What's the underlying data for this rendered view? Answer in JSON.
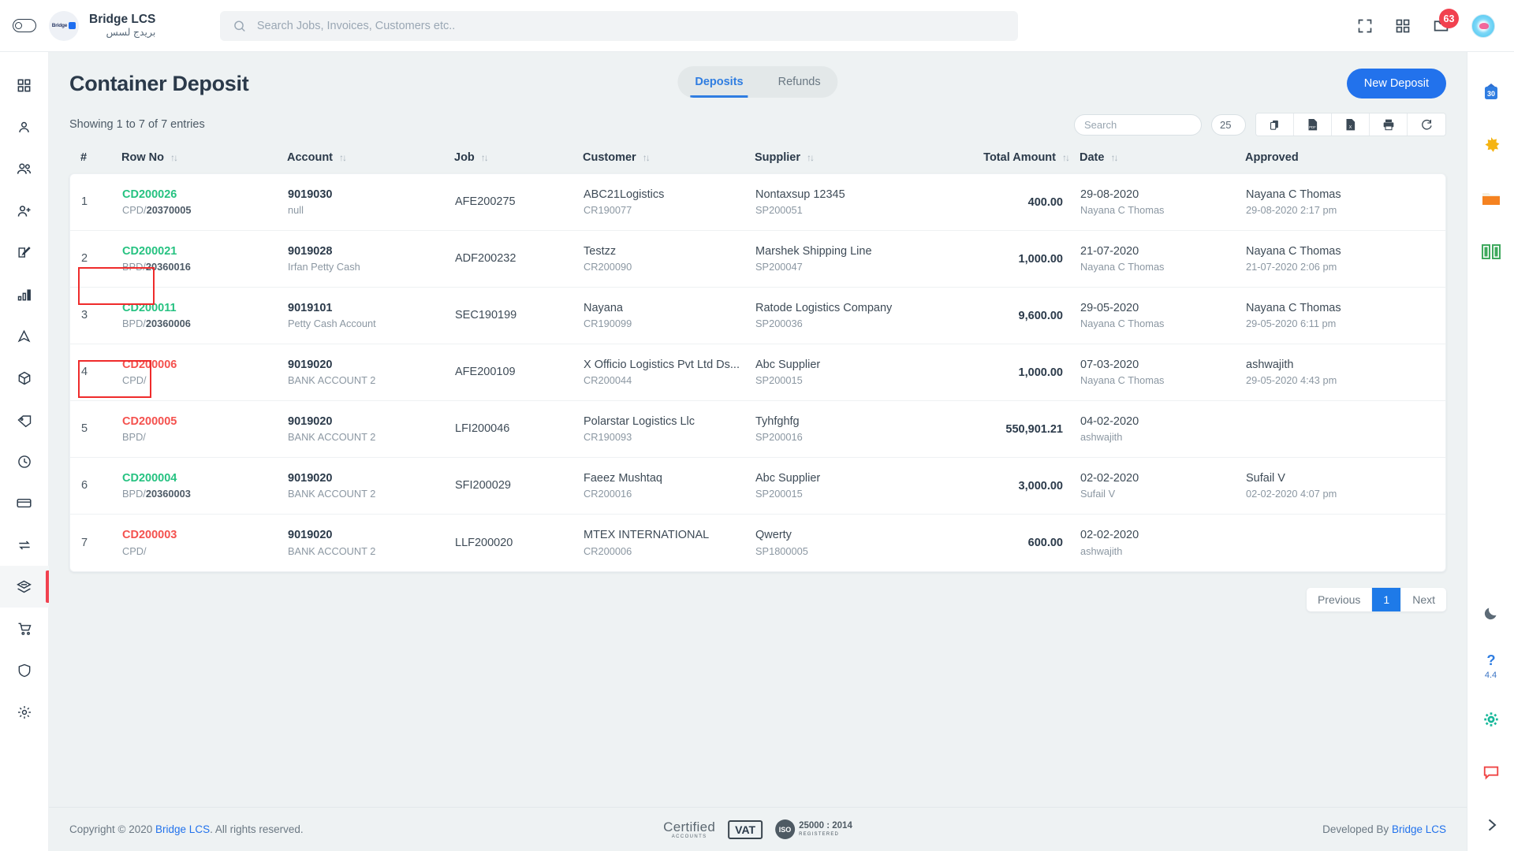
{
  "topbar": {
    "sidebar_toggle": "sidebar-toggle",
    "brand_name": "Bridge LCS",
    "brand_name_ar": "بريدج لسس",
    "logo_text": "Bridge",
    "search_placeholder": "Search Jobs, Invoices, Customers etc..",
    "search_value": "",
    "notification_count": "63"
  },
  "left_sidebar": {
    "items": [
      {
        "name": "dashboard",
        "icon": "grid-icon"
      },
      {
        "name": "user",
        "icon": "user-icon"
      },
      {
        "name": "users",
        "icon": "users-icon"
      },
      {
        "name": "add-user",
        "icon": "user-plus-icon"
      },
      {
        "name": "edit",
        "icon": "edit-square-icon"
      },
      {
        "name": "reports",
        "icon": "bar-chart-icon"
      },
      {
        "name": "navigation",
        "icon": "navigation-icon"
      },
      {
        "name": "packages",
        "icon": "box-icon"
      },
      {
        "name": "tags",
        "icon": "tag-icon"
      },
      {
        "name": "history",
        "icon": "clock-icon"
      },
      {
        "name": "payments",
        "icon": "credit-card-icon"
      },
      {
        "name": "transfers",
        "icon": "exchange-icon"
      },
      {
        "name": "container-deposit",
        "icon": "container-icon",
        "active": true
      },
      {
        "name": "purchase",
        "icon": "cart-icon"
      },
      {
        "name": "security",
        "icon": "shield-icon"
      },
      {
        "name": "settings",
        "icon": "gear-icon"
      }
    ]
  },
  "right_sidebar": {
    "items": [
      {
        "name": "calendar",
        "icon": "calendar-icon",
        "label": "30"
      },
      {
        "name": "highlights",
        "icon": "sparkle-icon"
      },
      {
        "name": "files",
        "icon": "folder-icon"
      },
      {
        "name": "knowledge-base",
        "icon": "book-icon"
      }
    ],
    "bottom_items": [
      {
        "name": "dark-mode",
        "icon": "moon-icon"
      },
      {
        "name": "help",
        "icon": "question-icon",
        "label": "4.4"
      },
      {
        "name": "settings",
        "icon": "gear-icon"
      },
      {
        "name": "chat",
        "icon": "chat-icon"
      },
      {
        "name": "expand",
        "icon": "chevron-right-icon"
      }
    ]
  },
  "page": {
    "title": "Container Deposit",
    "new_button": "New Deposit",
    "tabs": [
      {
        "label": "Deposits",
        "active": true
      },
      {
        "label": "Refunds",
        "active": false
      }
    ]
  },
  "toolbar": {
    "entries_text": "Showing 1 to 7 of 7 entries",
    "search_placeholder": "Search",
    "search_value": "",
    "page_length": "25",
    "buttons": [
      {
        "name": "copy-button",
        "icon": "copy-icon"
      },
      {
        "name": "pdf-export-button",
        "icon": "pdf-file-icon"
      },
      {
        "name": "excel-export-button",
        "icon": "excel-file-icon"
      },
      {
        "name": "print-button",
        "icon": "printer-icon"
      },
      {
        "name": "refresh-button",
        "icon": "refresh-icon"
      }
    ]
  },
  "table": {
    "columns": [
      {
        "label": "#",
        "sortable": false
      },
      {
        "label": "Row No",
        "sortable": true
      },
      {
        "label": "Account",
        "sortable": true
      },
      {
        "label": "Job",
        "sortable": true
      },
      {
        "label": "Customer",
        "sortable": true
      },
      {
        "label": "Supplier",
        "sortable": true
      },
      {
        "label": "Total Amount",
        "sortable": true
      },
      {
        "label": "Date",
        "sortable": true
      },
      {
        "label": "Approved",
        "sortable": false
      }
    ],
    "sort_glyph": "↑↓",
    "rows": [
      {
        "index": "1",
        "row_no": "CD200026",
        "row_no_color": "green",
        "row_ref_prefix": "CPD/",
        "row_ref_num": "20370005",
        "account": "9019030",
        "account_sub": "null",
        "job": "AFE200275",
        "customer": "ABC21Logistics",
        "customer_sub": "CR190077",
        "supplier": "Nontaxsup 12345",
        "supplier_sub": "SP200051",
        "amount": "400.00",
        "date": "29-08-2020",
        "date_sub": "Nayana C Thomas",
        "approved": "Nayana C Thomas",
        "approved_sub": "29-08-2020 2:17 pm",
        "highlight": false
      },
      {
        "index": "2",
        "row_no": "CD200021",
        "row_no_color": "green",
        "row_ref_prefix": "BPD/",
        "row_ref_num": "20360016",
        "account": "9019028",
        "account_sub": "Irfan Petty Cash",
        "job": "ADF200232",
        "customer": "Testzz",
        "customer_sub": "CR200090",
        "supplier": "Marshek Shipping Line",
        "supplier_sub": "SP200047",
        "amount": "1,000.00",
        "date": "21-07-2020",
        "date_sub": "Nayana C Thomas",
        "approved": "Nayana C Thomas",
        "approved_sub": "21-07-2020 2:06 pm",
        "highlight": false
      },
      {
        "index": "3",
        "row_no": "CD200011",
        "row_no_color": "green",
        "row_ref_prefix": "BPD/",
        "row_ref_num": "20360006",
        "account": "9019101",
        "account_sub": "Petty Cash Account",
        "job": "SEC190199",
        "customer": "Nayana",
        "customer_sub": "CR190099",
        "supplier": "Ratode Logistics Company",
        "supplier_sub": "SP200036",
        "amount": "9,600.00",
        "date": "29-05-2020",
        "date_sub": "Nayana C Thomas",
        "approved": "Nayana C Thomas",
        "approved_sub": "29-05-2020 6:11 pm",
        "highlight": true
      },
      {
        "index": "4",
        "row_no": "CD200006",
        "row_no_color": "red",
        "row_ref_prefix": "CPD/",
        "row_ref_num": "",
        "account": "9019020",
        "account_sub": "BANK ACCOUNT 2",
        "job": "AFE200109",
        "customer": "X Officio Logistics Pvt Ltd Ds...",
        "customer_sub": "CR200044",
        "supplier": "Abc Supplier",
        "supplier_sub": "SP200015",
        "amount": "1,000.00",
        "date": "07-03-2020",
        "date_sub": "Nayana C Thomas",
        "approved": "ashwajith",
        "approved_sub": "29-05-2020 4:43 pm",
        "highlight": false
      },
      {
        "index": "5",
        "row_no": "CD200005",
        "row_no_color": "red",
        "row_ref_prefix": "BPD/",
        "row_ref_num": "",
        "account": "9019020",
        "account_sub": "BANK ACCOUNT 2",
        "job": "LFI200046",
        "customer": "Polarstar Logistics Llc",
        "customer_sub": "CR190093",
        "supplier": "Tyhfghfg",
        "supplier_sub": "SP200016",
        "amount": "550,901.21",
        "date": "04-02-2020",
        "date_sub": "ashwajith",
        "approved": "",
        "approved_sub": "",
        "highlight": true
      },
      {
        "index": "6",
        "row_no": "CD200004",
        "row_no_color": "green",
        "row_ref_prefix": "BPD/",
        "row_ref_num": "20360003",
        "account": "9019020",
        "account_sub": "BANK ACCOUNT 2",
        "job": "SFI200029",
        "customer": "Faeez Mushtaq",
        "customer_sub": "CR200016",
        "supplier": "Abc Supplier",
        "supplier_sub": "SP200015",
        "amount": "3,000.00",
        "date": "02-02-2020",
        "date_sub": "Sufail V",
        "approved": "Sufail V",
        "approved_sub": "02-02-2020 4:07 pm",
        "highlight": false
      },
      {
        "index": "7",
        "row_no": "CD200003",
        "row_no_color": "red",
        "row_ref_prefix": "CPD/",
        "row_ref_num": "",
        "account": "9019020",
        "account_sub": "BANK ACCOUNT 2",
        "job": "LLF200020",
        "customer": "MTEX INTERNATIONAL",
        "customer_sub": "CR200006",
        "supplier": "Qwerty",
        "supplier_sub": "SP1800005",
        "amount": "600.00",
        "date": "02-02-2020",
        "date_sub": "ashwajith",
        "approved": "",
        "approved_sub": "",
        "highlight": false
      }
    ]
  },
  "pagination": {
    "previous": "Previous",
    "current": "1",
    "next": "Next"
  },
  "footer": {
    "copyright_pre": "Copyright © 2020",
    "brand_link": "Bridge LCS",
    "copyright_post": ". All rights reserved.",
    "cert_main": "Certified",
    "cert_sub": "ACCOUNTS",
    "vat": "VAT",
    "iso_seal": "ISO",
    "iso_main": "25000 : 2014",
    "iso_sub": "REGISTERED",
    "developed_pre": "Developed By",
    "developed_link": "Bridge LCS"
  },
  "colors": {
    "accent_blue": "#2272ec",
    "tab_blue": "#2f7de1",
    "green": "#26c281",
    "red": "#f4514e",
    "badge_red": "#f1414f",
    "annotation_red": "#ef2b2b",
    "page_bg": "#eef2f3"
  }
}
